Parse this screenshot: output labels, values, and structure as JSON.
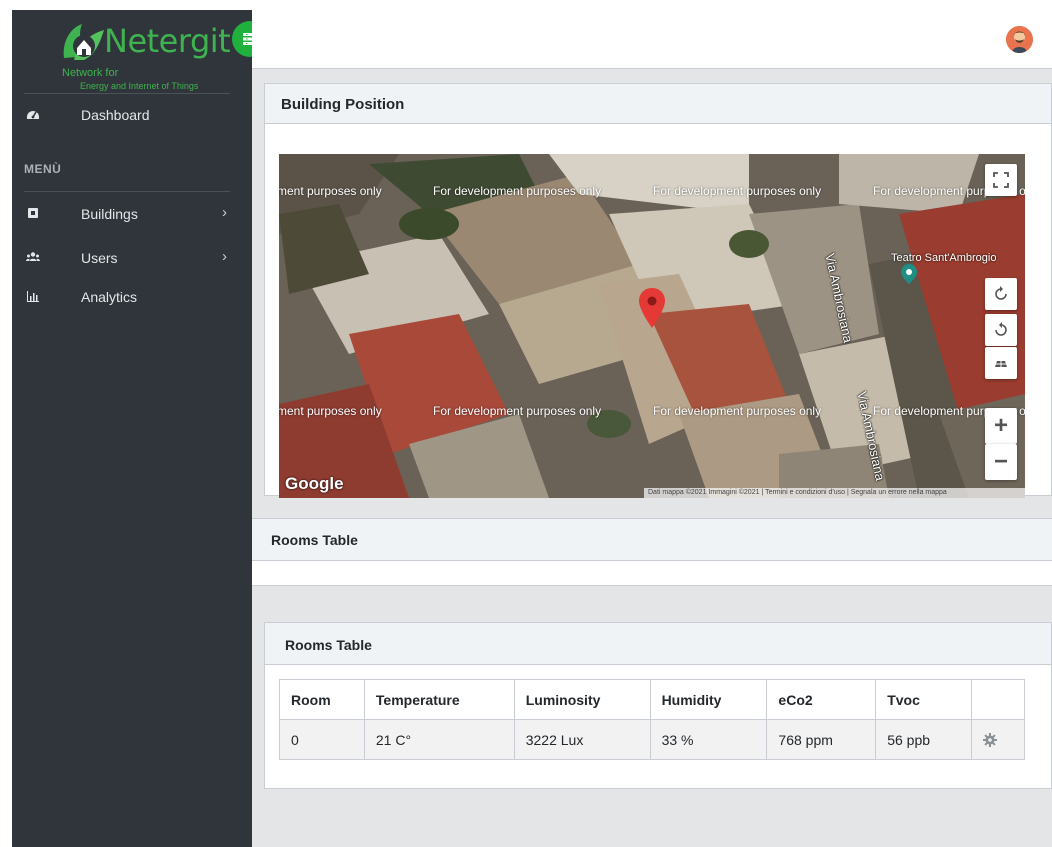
{
  "brand": {
    "name": "Netergit",
    "subtitle_line1": "Network for",
    "subtitle_line2": "Energy and Internet of Things"
  },
  "sidebar": {
    "dashboard": {
      "label": "Dashboard",
      "icon": "tachometer-icon"
    },
    "section_title": "MENÙ",
    "items": [
      {
        "label": "Buildings",
        "icon": "building-icon",
        "has_submenu": true
      },
      {
        "label": "Users",
        "icon": "users-icon",
        "has_submenu": true
      },
      {
        "label": "Analytics",
        "icon": "bar-chart-icon",
        "has_submenu": false
      }
    ],
    "chevron": "›"
  },
  "building_position": {
    "title": "Building Position",
    "map": {
      "watermark": "For development purposes only",
      "watermark_partial": "ment purposes only",
      "street_1": "Via Ambrosiana",
      "street_2": "Via Ambrosiana",
      "poi": "Teatro Sant'Ambrogio",
      "provider": "Google",
      "attribution": "Dati mappa ©2021 Immagini ©2021 | Termini e condizioni d'uso | Segnala un errore nella mappa",
      "controls": [
        "fullscreen",
        "rotate-clockwise",
        "rotate-counterclockwise",
        "tilt",
        "zoom-in",
        "zoom-out"
      ],
      "zoom_in_label": "+",
      "zoom_out_label": "−"
    }
  },
  "rooms_table_panel": {
    "title": "Rooms Table"
  },
  "rooms_table_card": {
    "title": "Rooms Table",
    "columns": [
      "Room",
      "Temperature",
      "Luminosity",
      "Humidity",
      "eCo2",
      "Tvoc",
      ""
    ],
    "rows": [
      {
        "room": "0",
        "temperature": "21 C°",
        "luminosity": "3222 Lux",
        "humidity": "33 %",
        "eco2": "768 ppm",
        "tvoc": "56 ppb",
        "action_icon": "gear-icon"
      }
    ]
  },
  "colors": {
    "sidebar_bg": "#2f353a",
    "brand_green": "#3fb34f",
    "toggle_green": "#20b03e",
    "main_bg": "#e4e5e6",
    "card_header_bg": "#f0f3f5",
    "marker_red": "#e53935"
  }
}
